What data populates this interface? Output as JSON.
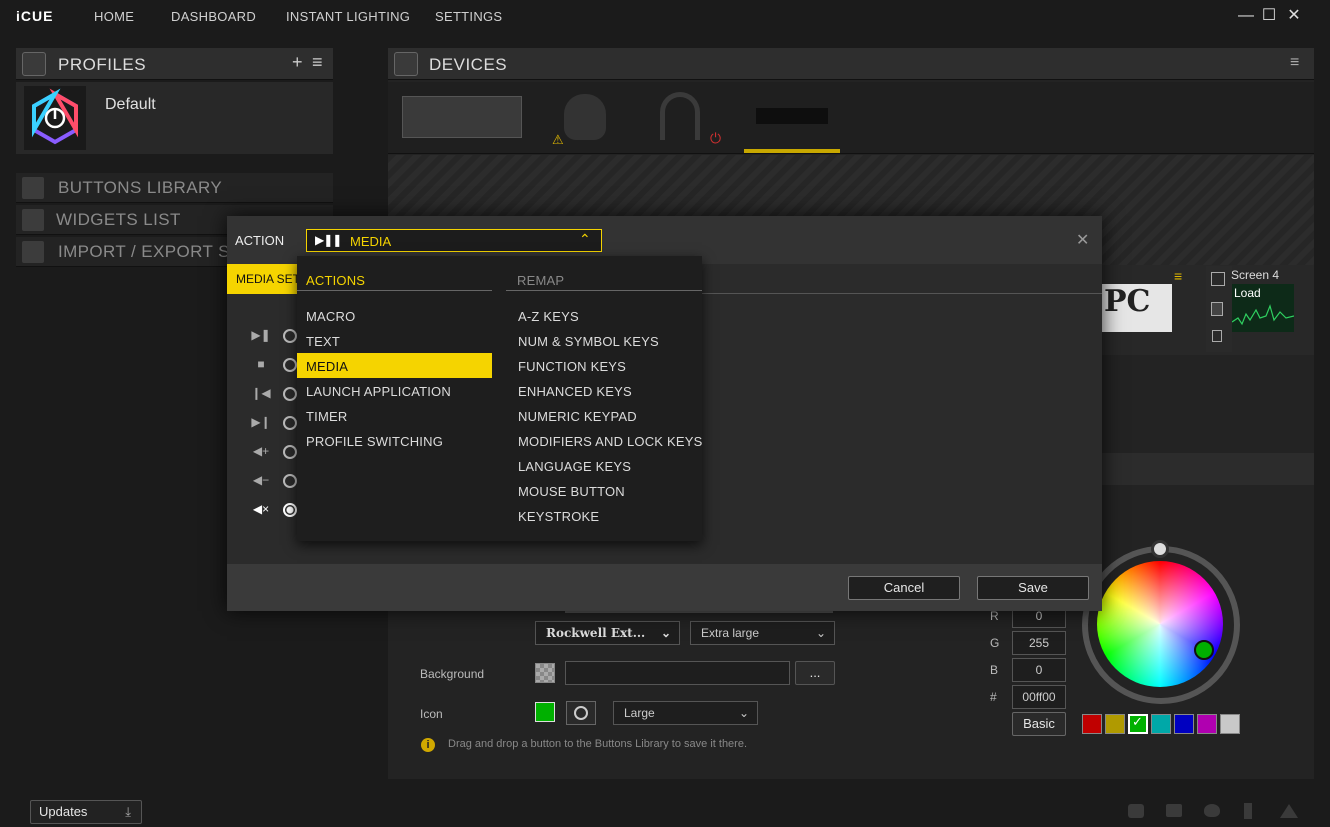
{
  "app": {
    "title": "iCUE"
  },
  "nav": [
    "HOME",
    "DASHBOARD",
    "INSTANT LIGHTING",
    "SETTINGS"
  ],
  "window": {
    "minimize": "—",
    "maximize": "☐",
    "close": "✕"
  },
  "profiles": {
    "title": "PROFILES",
    "add": "+",
    "menu": "≡",
    "items": [
      {
        "name": "Default"
      }
    ]
  },
  "left_sections": [
    "BUTTONS LIBRARY",
    "WIDGETS LIST",
    "IMPORT / EXPORT SCENES"
  ],
  "devices": {
    "title": "DEVICES",
    "menu": "≡",
    "warning": "⚠",
    "power": "⏻"
  },
  "widget": {
    "screen_label": "Screen 4",
    "load_label": "Load",
    "pc_text": "PC"
  },
  "modal": {
    "action_label": "ACTION",
    "selected_action": "MEDIA",
    "tab_label": "MEDIA SETTINGS",
    "close": "✕",
    "cancel": "Cancel",
    "save": "Save"
  },
  "dropdown": {
    "actions_header": "ACTIONS",
    "remap_header": "REMAP",
    "actions": [
      "MACRO",
      "TEXT",
      "MEDIA",
      "LAUNCH APPLICATION",
      "TIMER",
      "PROFILE SWITCHING"
    ],
    "remap": [
      "A-Z KEYS",
      "NUM & SYMBOL KEYS",
      "FUNCTION KEYS",
      "ENHANCED KEYS",
      "NUMERIC KEYPAD",
      "MODIFIERS AND LOCK KEYS",
      "LANGUAGE KEYS",
      "MOUSE BUTTON",
      "KEYSTROKE"
    ],
    "selected": "MEDIA"
  },
  "media_options": [
    "play-pause",
    "stop",
    "previous",
    "next",
    "volume-up",
    "volume-down",
    "mute"
  ],
  "media_selected": "mute",
  "editor": {
    "font_value": "Rockwell Ext...",
    "size_value": "Extra large",
    "background_label": "Background",
    "background_value": "",
    "browse": "...",
    "icon_label": "Icon",
    "icon_size": "Large",
    "hint": "Drag and drop a button to the Buttons Library to save it there."
  },
  "color": {
    "r_label": "R",
    "r": "0",
    "g_label": "G",
    "g": "255",
    "b_label": "B",
    "b": "0",
    "hex_label": "#",
    "hex": "00ff00",
    "mode": "Basic",
    "swatches": [
      "#c00000",
      "#b09a00",
      "#00b000",
      "#00a8a8",
      "#0000c0",
      "#b000b0",
      "#c8c8c8"
    ],
    "selected_swatch": "#00b000",
    "icon_color": "#00b000"
  },
  "bottom": {
    "updates": "Updates"
  },
  "accent": "#f5d400"
}
